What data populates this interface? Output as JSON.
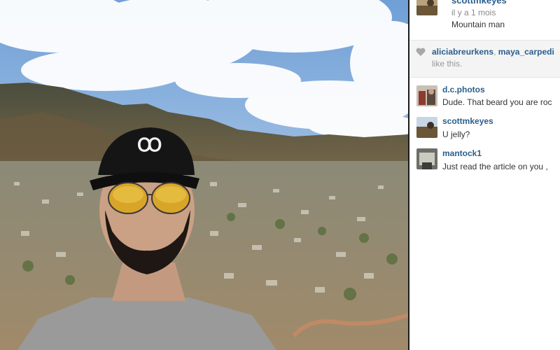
{
  "post": {
    "time": "il y a 1 mois",
    "caption": "Mountain man",
    "author_partial": "scottmkeyes"
  },
  "likes": {
    "users": [
      "aliciabreurkens",
      "maya_carpedi"
    ],
    "separator": ",",
    "suffix": "like this."
  },
  "comments": [
    {
      "user": "d.c.photos",
      "text": "Dude. That beard you are roc"
    },
    {
      "user": "scottmkeyes",
      "text": "U jelly?"
    },
    {
      "user": "mantock1",
      "text": "Just read the article on you ,"
    }
  ],
  "colors": {
    "link": "#2b5e8d",
    "muted": "#8a8a8a",
    "likes_bg": "#f4f4f4"
  },
  "icons": [
    "heart-icon"
  ]
}
